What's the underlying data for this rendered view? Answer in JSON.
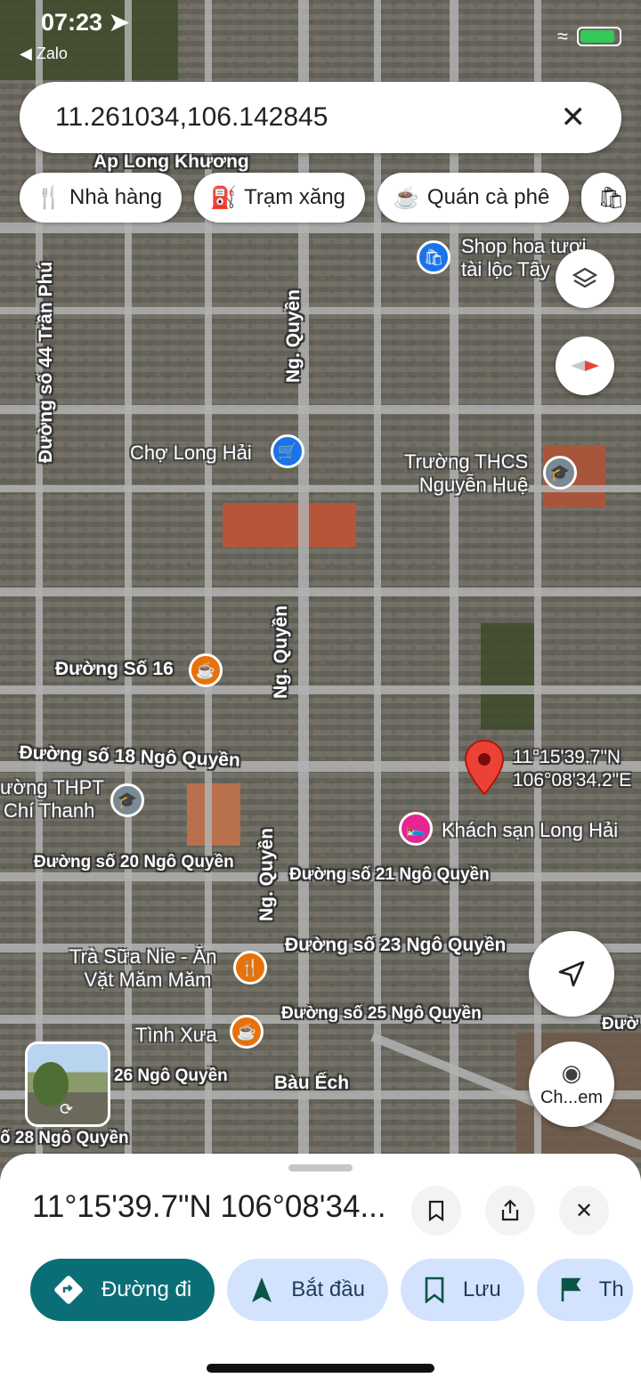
{
  "status_bar": {
    "time": "07:23",
    "back_app": "◀ Zalo"
  },
  "search": {
    "query": "11.261034,106.142845",
    "clear_icon": "close-icon"
  },
  "chips": [
    {
      "label": "Nhà hàng",
      "icon": "restaurant-icon"
    },
    {
      "label": "Trạm xăng",
      "icon": "gas-station-icon"
    },
    {
      "label": "Quán cà phê",
      "icon": "coffee-icon"
    },
    {
      "label": "",
      "icon": "shopping-icon"
    }
  ],
  "map": {
    "streets": {
      "ap_long_khuong": "Ấp Long Khương",
      "duong_so_44": "Đường số 44 Trần Phú",
      "ng_quyen_1": "Ng. Quyền",
      "ng_quyen_2": "Ng. Quyền",
      "ng_quyen_3": "Ng. Quyền",
      "duong_so_16": "Đường Số 16",
      "duong_so_18": "Đường số 18 Ngô Quyền",
      "duong_so_20": "Đường số 20 Ngô Quyền",
      "duong_so_21": "Đường số 21 Ngô Quyền",
      "duong_so_23": "Đường số 23 Ngô Quyền",
      "duong_so_25": "Đường số 25 Ngô Quyền",
      "duong_so_26": "26 Ngô Quyền",
      "duong_so_28": "ố 28 Ngô Quyền",
      "bau_ech": "Bàu Ếch",
      "duo_edge": "Đườ"
    },
    "pois": {
      "shop_hoa_1": "Shop hoa tươi",
      "shop_hoa_2": "tài lộc Tây",
      "cho_long_hai": "Chợ Long Hải",
      "truong_thcs_1": "Trường THCS",
      "truong_thcs_2": "Nguyễn Huệ",
      "thpt_1": "ường THPT",
      "thpt_2": "Chí Thanh",
      "khach_san": "Khách sạn Long Hải",
      "tra_sua_1": "Trà Sữa Nie - Ăn",
      "tra_sua_2": "Vặt Măm Măm",
      "tinh_xua": "Tình Xưa"
    },
    "pin": {
      "lat": "11°15'39.7\"N",
      "lng": "106°08'34.2\"E"
    },
    "camera_label": "Ch...em"
  },
  "sheet": {
    "title": "11°15'39.7\"N 106°08'34...",
    "actions": [
      {
        "label": "Đường đi",
        "icon": "directions-icon"
      },
      {
        "label": "Bắt đầu",
        "icon": "navigation-arrow-icon"
      },
      {
        "label": "Lưu",
        "icon": "bookmark-icon"
      },
      {
        "label": "Th",
        "icon": "flag-icon"
      }
    ]
  },
  "colors": {
    "primary_action": "#0b6e77",
    "secondary_action": "#d3e3fd",
    "pin_red": "#ea4335",
    "poi_blue": "#1a73e8",
    "poi_orange": "#e8710a",
    "poi_pink": "#e52592"
  }
}
